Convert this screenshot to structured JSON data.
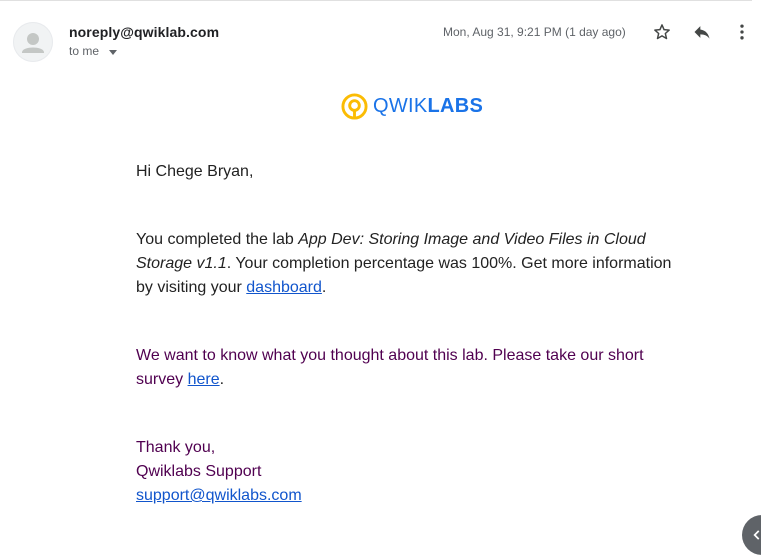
{
  "email": {
    "sender": "noreply@qwiklab.com",
    "recipient_label": "to me",
    "date": "Mon, Aug 31, 9:21 PM (1 day ago)"
  },
  "logo": {
    "part1": "QWIK",
    "part2": "LABS"
  },
  "content": {
    "greeting": "Hi Chege Bryan,",
    "p1_before": "You completed the lab ",
    "p1_lab_name": "App Dev: Storing Image and Video Files in Cloud Storage v1.1",
    "p1_after": ". Your completion percentage was 100%. Get more information by visiting your ",
    "p1_link": "dashboard",
    "p1_end": ".",
    "p2_text": "We want to know what you thought about this lab. Please take our short survey ",
    "p2_link": "here",
    "p2_end": ".",
    "sign_thanks": "Thank you,",
    "sign_team": "Qwiklabs Support",
    "sign_email": "support@qwiklabs.com"
  },
  "icons": {
    "avatar": "person-icon",
    "star": "star-outline-icon",
    "reply": "reply-icon",
    "more": "more-vert-icon",
    "fab": "chevron-left-icon"
  },
  "colors": {
    "link": "#1155cc",
    "purple_text": "#500050",
    "logo_yellow": "#fbbc04",
    "logo_blue": "#1a73e8"
  }
}
